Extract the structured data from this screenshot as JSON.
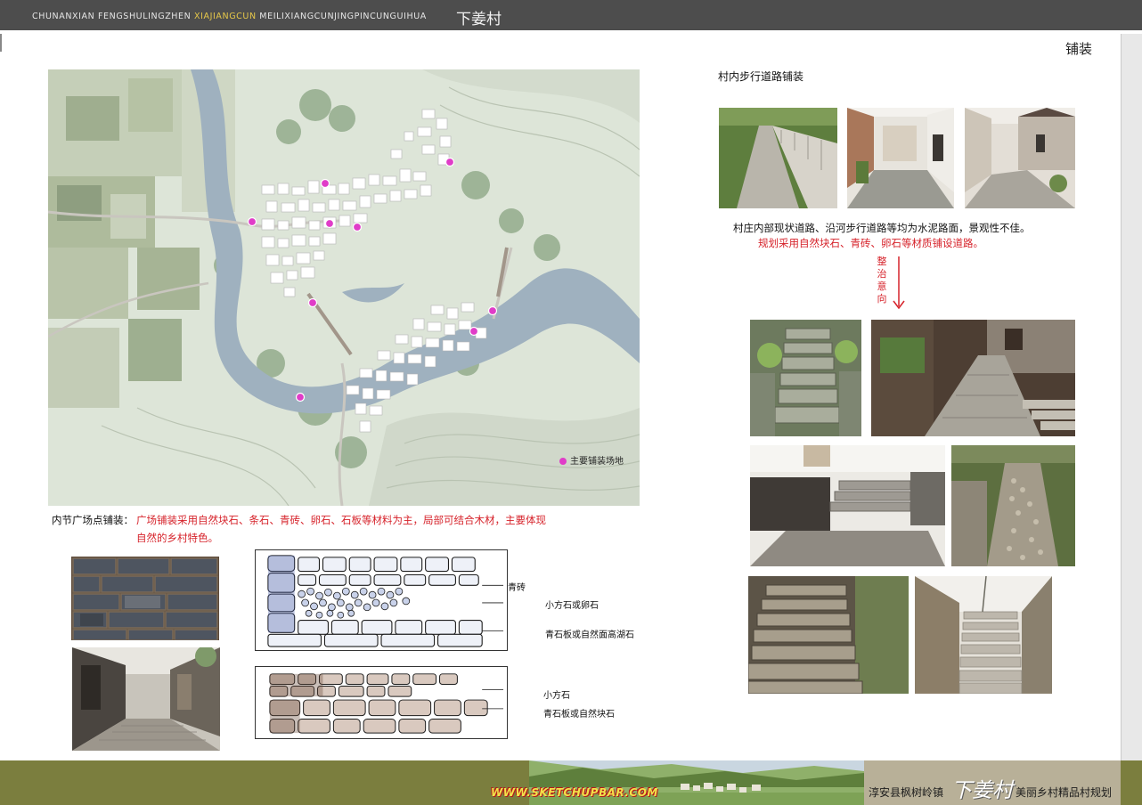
{
  "header": {
    "en_part1": "CHUNANXIAN  FENGSHULINGZHEN  ",
    "en_highlight": "XIAJIANGCUN",
    "en_part2": "  MEILIXIANGCUNJINGPINCUNGUIHUA",
    "cn_title": "下姜村"
  },
  "section_title": "铺装",
  "map": {
    "legend_label": "主要铺装场地",
    "marker_color": "#e03cc8",
    "water_color": "#9fb1bf"
  },
  "plaza": {
    "title": "内节广场点铺装：",
    "desc_line1": "广场铺装采用自然块石、条石、青砖、卵石、石板等材料为主，局部可结合木材，主要体现",
    "desc_line2": "自然的乡村特色。"
  },
  "sketch1": {
    "labels": [
      "青砖",
      "小方石或卵石",
      "青石板或自然面高湖石"
    ]
  },
  "sketch2": {
    "labels": [
      "小方石",
      "青石板或自然块石"
    ]
  },
  "paths": {
    "title": "村内步行道路铺装",
    "note_line1": "村庄内部现状道路、沿河步行道路等均为水泥路面，景观性不佳。",
    "note_line2": "规划采用自然块石、青砖、卵石等材质铺设道路。",
    "arrow_text": "整治意向"
  },
  "footer": {
    "url": "WWW.SKETCHUPBAR.COM",
    "town": "淳安县枫树岭镇",
    "logo": "下姜村",
    "plan": "美丽乡村精品村规划"
  },
  "colors": {
    "header_bg": "#4d4d4d",
    "accent_red": "#d6222a",
    "footer_bg": "#7b7e3e"
  }
}
